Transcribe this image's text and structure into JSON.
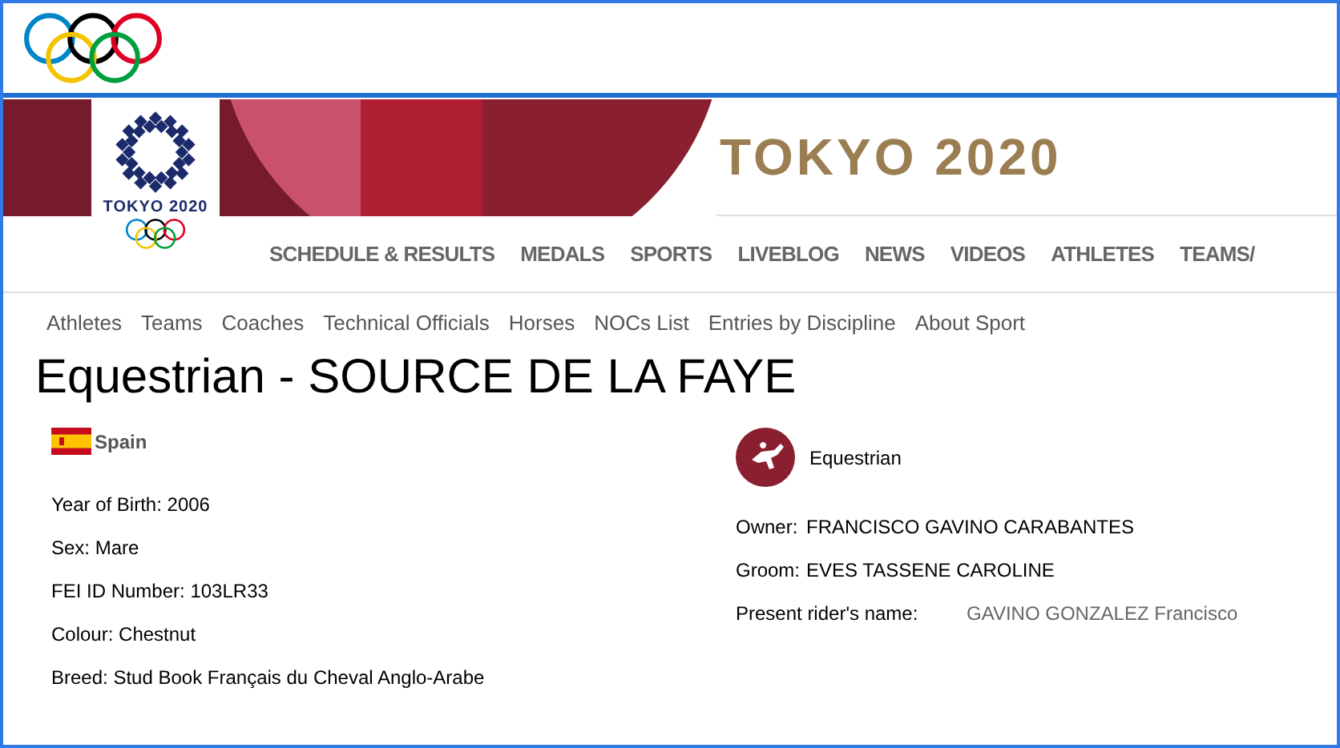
{
  "banner": {
    "title": "TOKYO 2020",
    "emblem_caption": "TOKYO 2020"
  },
  "main_nav": [
    {
      "label": "SCHEDULE & RESULTS"
    },
    {
      "label": "MEDALS"
    },
    {
      "label": "SPORTS"
    },
    {
      "label": "LIVEBLOG"
    },
    {
      "label": "NEWS"
    },
    {
      "label": "VIDEOS"
    },
    {
      "label": "ATHLETES"
    },
    {
      "label": "TEAMS/"
    }
  ],
  "sub_nav": [
    {
      "label": "Athletes"
    },
    {
      "label": "Teams"
    },
    {
      "label": "Coaches"
    },
    {
      "label": "Technical Officials"
    },
    {
      "label": "Horses"
    },
    {
      "label": "NOCs List"
    },
    {
      "label": "Entries by Discipline"
    },
    {
      "label": "About Sport"
    }
  ],
  "title": "Equestrian - SOURCE DE LA FAYE",
  "country": "Spain",
  "sport": "Equestrian",
  "details": [
    {
      "label": "Year of Birth:",
      "value": "2006"
    },
    {
      "label": "Sex:",
      "value": "Mare"
    },
    {
      "label": "FEI ID Number:",
      "value": "103LR33"
    },
    {
      "label": "Colour:",
      "value": "Chestnut"
    },
    {
      "label": "Breed:",
      "value": "Stud Book Français du Cheval Anglo-Arabe"
    }
  ],
  "people": [
    {
      "label": "Owner:",
      "value": "FRANCISCO GAVINO CARABANTES",
      "kind": "text"
    },
    {
      "label": "Groom:",
      "value": "EVES TASSENE CAROLINE",
      "kind": "text"
    },
    {
      "label": "Present rider's name:",
      "value": "GAVINO GONZALEZ Francisco",
      "kind": "link"
    }
  ]
}
